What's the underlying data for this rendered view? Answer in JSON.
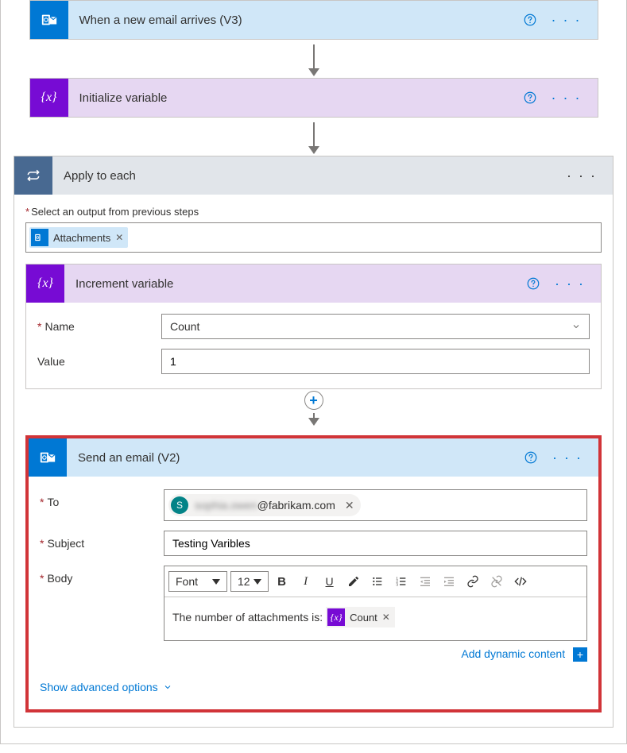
{
  "trigger": {
    "title": "When a new email arrives (V3)"
  },
  "init_var": {
    "title": "Initialize variable"
  },
  "apply_each": {
    "title": "Apply to each",
    "select_label": "Select an output from previous steps",
    "token": "Attachments"
  },
  "increment": {
    "title": "Increment variable",
    "name_label": "Name",
    "name_value": "Count",
    "value_label": "Value",
    "value_value": "1"
  },
  "send_email": {
    "title": "Send an email (V2)",
    "to_label": "To",
    "to_avatar": "S",
    "to_hidden": "sophia.owen",
    "to_domain": "@fabrikam.com",
    "subject_label": "Subject",
    "subject_value": "Testing Varibles",
    "body_label": "Body",
    "body_text": "The number of attachments is: ",
    "body_var": "Count",
    "font_label": "Font",
    "font_size": "12",
    "dynamic_link": "Add dynamic content",
    "advanced_link": "Show advanced options"
  }
}
